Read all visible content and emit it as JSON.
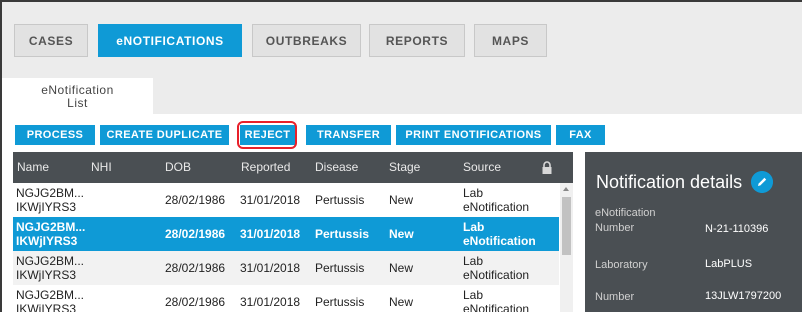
{
  "top_tabs": [
    {
      "label": "CASES",
      "active": false
    },
    {
      "label": "eNOTIFICATIONS",
      "active": true
    },
    {
      "label": "OUTBREAKS",
      "active": false
    },
    {
      "label": "REPORTS",
      "active": false
    },
    {
      "label": "MAPS",
      "active": false
    }
  ],
  "subtab": {
    "line1": "eNotification",
    "line2": "List"
  },
  "toolbar": {
    "process": "PROCESS",
    "create_duplicate": "CREATE DUPLICATE",
    "reject": "REJECT",
    "transfer": "TRANSFER",
    "print": "PRINT ENOTIFICATIONS",
    "fax": "FAX"
  },
  "table": {
    "columns": [
      "Name",
      "NHI",
      "DOB",
      "Reported",
      "Disease",
      "Stage",
      "Source"
    ],
    "rows": [
      {
        "name1": "NGJG2BM...",
        "name2": "IKWjIYRS3",
        "nhi": "",
        "dob": "28/02/1986",
        "reported": "31/01/2018",
        "disease": "Pertussis",
        "stage": "New",
        "source1": "Lab",
        "source2": "eNotification"
      },
      {
        "name1": "NGJG2BM...",
        "name2": "IKWjIYRS3",
        "nhi": "",
        "dob": "28/02/1986",
        "reported": "31/01/2018",
        "disease": "Pertussis",
        "stage": "New",
        "source1": "Lab",
        "source2": "eNotification"
      },
      {
        "name1": "NGJG2BM...",
        "name2": "IKWjIYRS3",
        "nhi": "",
        "dob": "28/02/1986",
        "reported": "31/01/2018",
        "disease": "Pertussis",
        "stage": "New",
        "source1": "Lab",
        "source2": "eNotification"
      },
      {
        "name1": "NGJG2BM...",
        "name2": "IKWjIYRS3",
        "nhi": "",
        "dob": "28/02/1986",
        "reported": "31/01/2018",
        "disease": "Pertussis",
        "stage": "New",
        "source1": "Lab",
        "source2": "eNotification"
      }
    ]
  },
  "details": {
    "title": "Notification details",
    "fields": [
      {
        "label1": "eNotification",
        "label2": "Number",
        "value": "N-21-110396"
      },
      {
        "label1": "Laboratory",
        "label2": "",
        "value": "LabPLUS"
      },
      {
        "label1": "Number",
        "label2": "",
        "value": "13JLW1797200"
      }
    ]
  },
  "colors": {
    "accent": "#0f9ad6",
    "dark_panel": "#4a4f53",
    "highlight": "#e8202a"
  },
  "icons": [
    "lock-icon",
    "pencil-icon",
    "scroll-up-icon"
  ]
}
